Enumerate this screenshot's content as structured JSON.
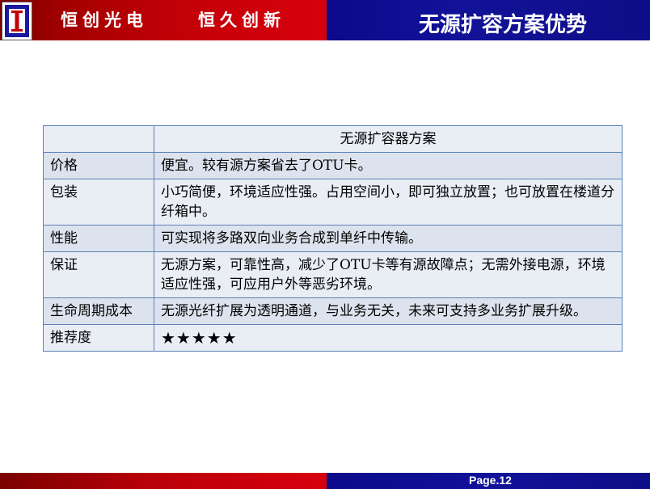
{
  "header": {
    "slogan_left": "恒创光电",
    "slogan_right": "恒久创新",
    "title": "无源扩容方案优势"
  },
  "table": {
    "column_header": "无源扩容器方案",
    "rows": [
      {
        "label": "价格",
        "value": "便宜。较有源方案省去了OTU卡。"
      },
      {
        "label": "包装",
        "value": "小巧简便，环境适应性强。占用空间小，即可独立放置；也可放置在楼道分纤箱中。"
      },
      {
        "label": "性能",
        "value": "可实现将多路双向业务合成到单纤中传输。"
      },
      {
        "label": "保证",
        "value": "无源方案，可靠性高，减少了OTU卡等有源故障点；无需外接电源，环境适应性强，可应用户外等恶劣环境。"
      },
      {
        "label": "生命周期成本",
        "value": "无源光纤扩展为透明通道，与业务无关，未来可支持多业务扩展升级。"
      },
      {
        "label": "推荐度",
        "value": "★★★★★"
      }
    ]
  },
  "footer": {
    "page": "Page.12"
  },
  "colors": {
    "brand_red": "#c20008",
    "brand_blue": "#121299",
    "table_border": "#5b82b8",
    "table_fill": "#e9edf4"
  },
  "icons": {
    "logo": "company-logo-icon"
  }
}
